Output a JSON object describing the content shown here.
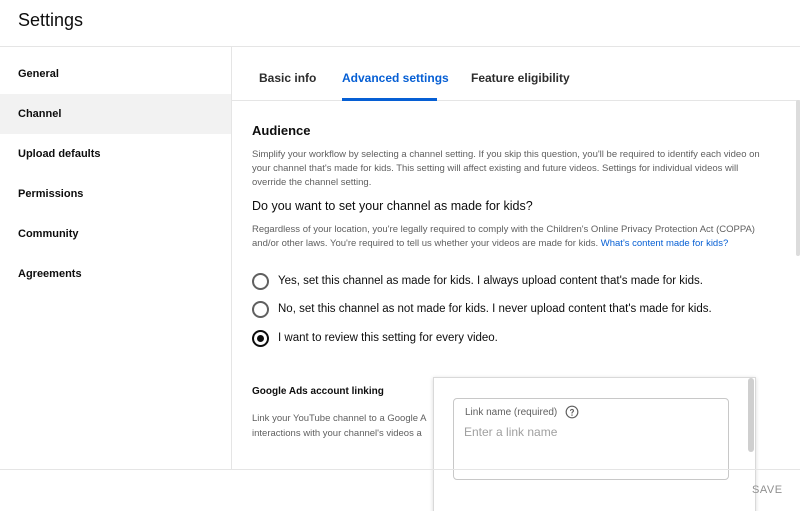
{
  "header": {
    "title": "Settings"
  },
  "sidebar": {
    "items": [
      {
        "label": "General"
      },
      {
        "label": "Channel"
      },
      {
        "label": "Upload defaults"
      },
      {
        "label": "Permissions"
      },
      {
        "label": "Community"
      },
      {
        "label": "Agreements"
      }
    ],
    "active": "Channel"
  },
  "tabs": [
    {
      "label": "Basic info"
    },
    {
      "label": "Advanced settings"
    },
    {
      "label": "Feature eligibility"
    }
  ],
  "active_tab": "Advanced settings",
  "audience": {
    "title": "Audience",
    "description": "Simplify your workflow by selecting a channel setting. If you skip this question, you'll be required to identify each video on your channel that's made for kids. This setting will affect existing and future videos. Settings for individual videos will override the channel setting.",
    "question": "Do you want to set your channel as made for kids?",
    "legal_text": "Regardless of your location, you're legally required to comply with the Children's Online Privacy Protection Act (COPPA) and/or other laws. You're required to tell us whether your videos are made for kids. ",
    "legal_link": "What's content made for kids?",
    "options": [
      {
        "label": "Yes, set this channel as made for kids. I always upload content that's made for kids."
      },
      {
        "label": "No, set this channel as not made for kids. I never upload content that's made for kids."
      },
      {
        "label": "I want to review this setting for every video."
      }
    ],
    "selected": "I want to review this setting for every video."
  },
  "ads": {
    "title": "Google Ads account linking",
    "description_line1": "Link your YouTube channel to a Google A",
    "description_line2": "interactions with your channel's videos a"
  },
  "popup": {
    "field_label": "Link name (required)",
    "placeholder": "Enter a link name",
    "value": ""
  },
  "footer": {
    "save_label": "SAVE"
  },
  "colors": {
    "accent": "#065fd4",
    "text": "#0d0d0d",
    "secondary_text": "#606060",
    "active_bg": "#f2f2f2"
  }
}
